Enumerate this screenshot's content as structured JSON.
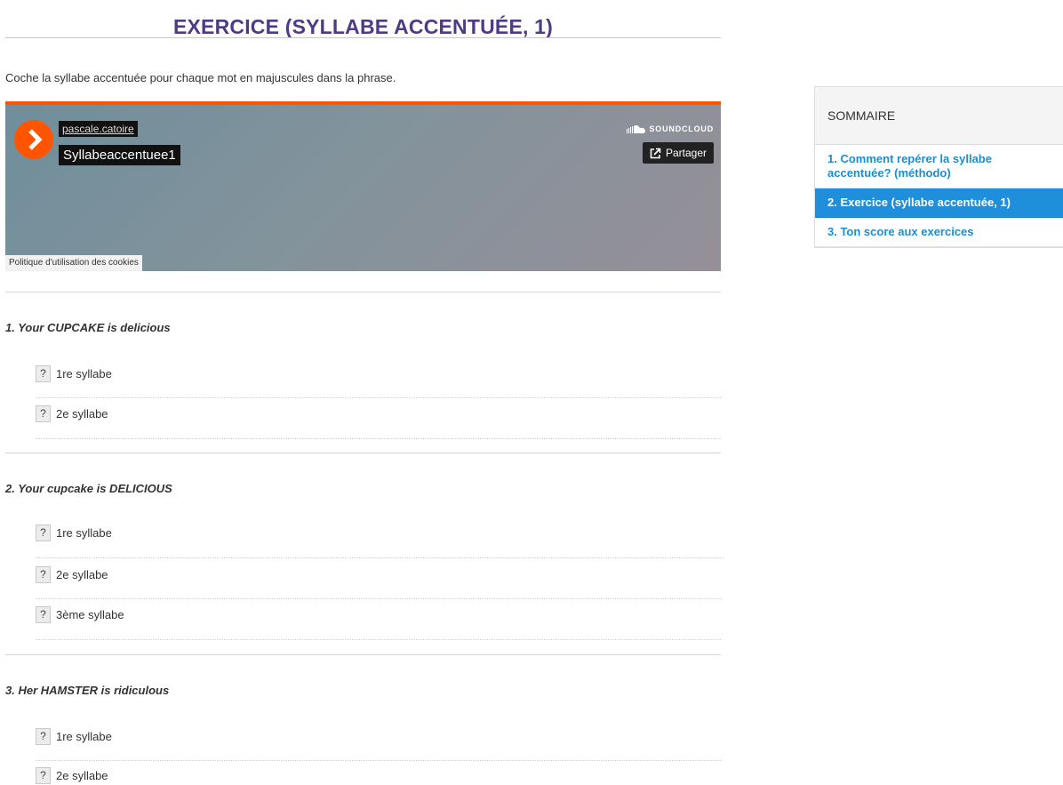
{
  "page": {
    "title": "EXERCICE (SYLLABE ACCENTUÉE, 1)",
    "instructions": "Coche la syllabe accentuée pour chaque mot en majuscules dans la phrase."
  },
  "player": {
    "artist": "pascale.catoire",
    "track": "Syllabeaccentuee1",
    "brand": "SOUNDCLOUD",
    "share_label": "Partager",
    "cookie_label": "Politique d'utilisation des cookies",
    "accent_color": "#ff5500"
  },
  "questions": [
    {
      "title": "1. Your CUPCAKE is delicious",
      "options": [
        "1re syllabe",
        "2e syllabe"
      ]
    },
    {
      "title": "2. Your cupcake is DELICIOUS",
      "options": [
        "1re syllabe",
        "2e syllabe",
        "3ème syllabe"
      ]
    },
    {
      "title": "3. Her HAMSTER is ridiculous",
      "options": [
        "1re syllabe",
        "2e syllabe"
      ]
    }
  ],
  "option_marker": "?",
  "sidebar": {
    "heading": "SOMMAIRE",
    "items": [
      {
        "label": "1. Comment repérer la syllabe accentuée? (méthodo)",
        "active": false
      },
      {
        "label": "2. Exercice (syllabe accentuée, 1)",
        "active": true
      },
      {
        "label": "3. Ton score aux exercices",
        "active": false
      }
    ]
  },
  "colors": {
    "title": "#4f3a85",
    "link": "#1a8fd0",
    "active_bg": "#1f8fdb"
  }
}
